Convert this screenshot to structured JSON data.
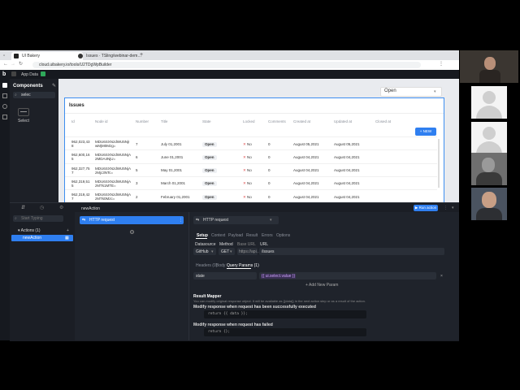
{
  "browser": {
    "tabs": [
      {
        "label": "UI Bakery"
      },
      {
        "label": "Issues · TSling/webinar-dem…"
      }
    ],
    "url": "cloud.uibakery.io/tools/U2TDgWpBuilder"
  },
  "app": {
    "brand": "b",
    "appbar_label": "App Data",
    "components_title": "Components",
    "components_search": "selec",
    "component_select_label": "Select"
  },
  "canvas": {
    "dropdown_value": "Open",
    "table_title": "Issues",
    "new_button": "+ NEW",
    "columns": [
      "Id",
      "Node id",
      "Number",
      "Title",
      "State",
      "Locked",
      "Comments",
      "Created at",
      "Updated at",
      "Closed at"
    ],
    "rows": [
      {
        "id": "962,023,43\n8",
        "node": "MDU6SXNzdWU5NjI\nwMjM0Mzg=",
        "number": "7",
        "title": "July 01,2001",
        "state": "Open",
        "locked": "No",
        "comments": "0",
        "created": "August 05,2021",
        "updated": "August 05,2021"
      },
      {
        "id": "962,600,16\n5",
        "node": "MDU6SXNzdWU5NjA\n2MDA4NjU=",
        "number": "6",
        "title": "June 01,2001",
        "state": "Open",
        "locked": "No",
        "comments": "0",
        "created": "August 04,2021",
        "updated": "August 04,2021"
      },
      {
        "id": "962,327,75\n7",
        "node": "MDU6SXNzdWU5NjA\nzMjc3NTc=",
        "number": "5",
        "title": "May 01,2001",
        "state": "Open",
        "locked": "No",
        "comments": "0",
        "created": "August 04,2021",
        "updated": "August 04,2021"
      },
      {
        "id": "962,319,51\n5",
        "node": "MDU6SXNzdWU5NjA\nzMTk1MTE=",
        "number": "3",
        "title": "March 01,2001",
        "state": "Open",
        "locked": "No",
        "comments": "0",
        "created": "August 04,2021",
        "updated": "August 04,2021"
      },
      {
        "id": "962,319,42\n7",
        "node": "MDU6SXNzdWU5NjA\nzMTk0Mzc=",
        "number": "2",
        "title": "February 01,2001",
        "state": "Open",
        "locked": "No",
        "comments": "0",
        "created": "August 04,2021",
        "updated": "August 04,2021"
      }
    ]
  },
  "bottom": {
    "action_name": "newAction",
    "run_button": "Run action",
    "search_placeholder": "Start Typing",
    "actions_group": "Actions (1)",
    "actions_item": "newAction",
    "step_label": "HTTP request",
    "step_type": "HTTP request",
    "tabs": [
      "Setup",
      "Context",
      "Payload",
      "Result",
      "Errors",
      "Options"
    ],
    "labels": {
      "datasource": "Datasource",
      "method": "Method",
      "base_url": "Base URL",
      "url": "URL"
    },
    "datasource": "GitHub",
    "method": "GET",
    "base_url": "https://api…",
    "url_value": "/issues",
    "subtabs": [
      "Headers (0)",
      "Body",
      "Query Params (1)"
    ],
    "param_key": "state",
    "param_value": "{{ ui.select.value }}",
    "add_param": "+ Add New Param",
    "result_mapper_title": "Result Mapper",
    "result_mapper_desc": "You can modify original response object. It will be available as {{data}} in the next action step or as a result of the action.",
    "success_title": "Modify response when request has been successfully executed",
    "success_code": "return {{ data }};",
    "fail_title": "Modify response when request has failed",
    "fail_code": "return {};"
  },
  "colors": {
    "accent": "#2f7ff0",
    "panel": "#1f232b",
    "open_pill": "#eef0f3",
    "no_x": "#e04a4a"
  }
}
